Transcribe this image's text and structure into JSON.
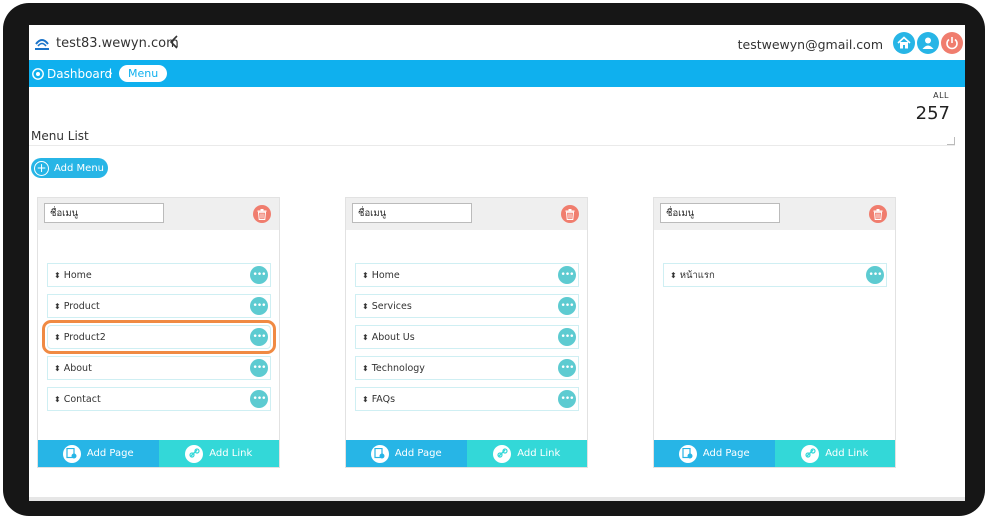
{
  "topbar": {
    "site_name": "test83.wewyn.com",
    "collapse_glyph": "‹",
    "email": "testwewyn@gmail.com",
    "icons": [
      "home-icon",
      "user-icon",
      "power-icon"
    ]
  },
  "breadcrumb": {
    "home": "Dashboard",
    "separator": "›",
    "current": "Menu"
  },
  "header": {
    "all_label": "ALL",
    "all_count": "257",
    "title": "Menu List"
  },
  "add_menu": {
    "label": "Add  Menu"
  },
  "colors": {
    "primary": "#0fb0ee",
    "accent": "#27b5e6",
    "teal": "#33d8d8",
    "danger": "#f07d6e",
    "highlight": "#f08a43"
  },
  "cards": [
    {
      "name_value": "ชื่อเมนู",
      "items": [
        "Home",
        "Product",
        "Product2",
        "About",
        "Contact"
      ],
      "highlight_index": 2,
      "add_page": "Add Page",
      "add_link": "Add Link"
    },
    {
      "name_value": "ชื่อเมนู",
      "items": [
        "Home",
        "Services",
        "About Us",
        "Technology",
        "FAQs"
      ],
      "add_page": "Add Page",
      "add_link": "Add Link"
    },
    {
      "name_value": "ชื่อเมนู",
      "items": [
        "หน้าแรก"
      ],
      "add_page": "Add Page",
      "add_link": "Add Link"
    }
  ],
  "glyphs": {
    "sort": "⬍",
    "more": "•••"
  }
}
